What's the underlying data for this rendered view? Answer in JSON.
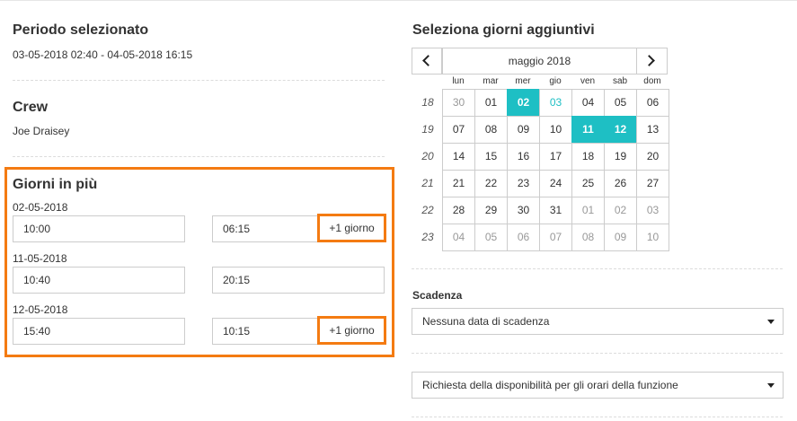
{
  "period": {
    "title": "Periodo selezionato",
    "range": "03-05-2018 02:40 - 04-05-2018 16:15"
  },
  "crew": {
    "title": "Crew",
    "name": "Joe Draisey"
  },
  "extra_days": {
    "title": "Giorni in più",
    "entries": [
      {
        "date": "02-05-2018",
        "start": "10:00",
        "end": "06:15",
        "plus_label": "+1 giorno"
      },
      {
        "date": "11-05-2018",
        "start": "10:40",
        "end": "20:15",
        "plus_label": ""
      },
      {
        "date": "12-05-2018",
        "start": "15:40",
        "end": "10:15",
        "plus_label": "+1 giorno"
      }
    ]
  },
  "calendar": {
    "title": "Seleziona giorni aggiuntivi",
    "month_label": "maggio 2018",
    "prev_icon": "chevron-left-icon",
    "next_icon": "chevron-right-icon",
    "weekdays": [
      "lun",
      "mar",
      "mer",
      "gio",
      "ven",
      "sab",
      "dom"
    ],
    "weeks": [
      {
        "num": "18",
        "days": [
          {
            "d": "30",
            "state": "other"
          },
          {
            "d": "01",
            "state": ""
          },
          {
            "d": "02",
            "state": "selected"
          },
          {
            "d": "03",
            "state": "today"
          },
          {
            "d": "04",
            "state": ""
          },
          {
            "d": "05",
            "state": ""
          },
          {
            "d": "06",
            "state": ""
          }
        ]
      },
      {
        "num": "19",
        "days": [
          {
            "d": "07",
            "state": ""
          },
          {
            "d": "08",
            "state": ""
          },
          {
            "d": "09",
            "state": ""
          },
          {
            "d": "10",
            "state": ""
          },
          {
            "d": "11",
            "state": "selected"
          },
          {
            "d": "12",
            "state": "selected"
          },
          {
            "d": "13",
            "state": ""
          }
        ]
      },
      {
        "num": "20",
        "days": [
          {
            "d": "14",
            "state": ""
          },
          {
            "d": "15",
            "state": ""
          },
          {
            "d": "16",
            "state": ""
          },
          {
            "d": "17",
            "state": ""
          },
          {
            "d": "18",
            "state": ""
          },
          {
            "d": "19",
            "state": ""
          },
          {
            "d": "20",
            "state": ""
          }
        ]
      },
      {
        "num": "21",
        "days": [
          {
            "d": "21",
            "state": ""
          },
          {
            "d": "22",
            "state": ""
          },
          {
            "d": "23",
            "state": ""
          },
          {
            "d": "24",
            "state": ""
          },
          {
            "d": "25",
            "state": ""
          },
          {
            "d": "26",
            "state": ""
          },
          {
            "d": "27",
            "state": ""
          }
        ]
      },
      {
        "num": "22",
        "days": [
          {
            "d": "28",
            "state": ""
          },
          {
            "d": "29",
            "state": ""
          },
          {
            "d": "30",
            "state": ""
          },
          {
            "d": "31",
            "state": ""
          },
          {
            "d": "01",
            "state": "other"
          },
          {
            "d": "02",
            "state": "other"
          },
          {
            "d": "03",
            "state": "other"
          }
        ]
      },
      {
        "num": "23",
        "days": [
          {
            "d": "04",
            "state": "other"
          },
          {
            "d": "05",
            "state": "other"
          },
          {
            "d": "06",
            "state": "other"
          },
          {
            "d": "07",
            "state": "other"
          },
          {
            "d": "08",
            "state": "other"
          },
          {
            "d": "09",
            "state": "other"
          },
          {
            "d": "10",
            "state": "other"
          }
        ]
      }
    ]
  },
  "expiry": {
    "label": "Scadenza",
    "selected": "Nessuna data di scadenza"
  },
  "availability": {
    "selected": "Richiesta della disponibilità per gli orari della funzione"
  },
  "colors": {
    "accent": "#1ebfc4",
    "highlight_border": "#f47b12"
  }
}
